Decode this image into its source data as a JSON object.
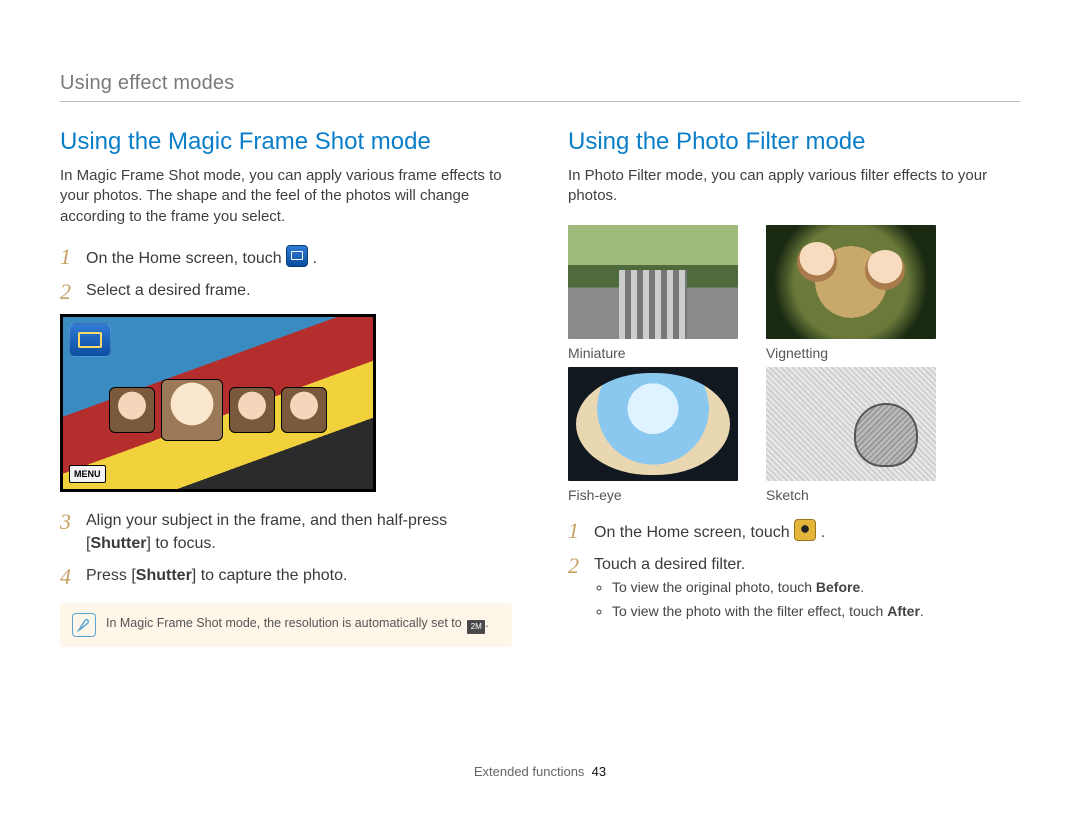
{
  "breadcrumb": "Using effect modes",
  "left": {
    "title": "Using the Magic Frame Shot mode",
    "intro": "In Magic Frame Shot mode, you can apply various frame effects to your photos. The shape and the feel of the photos will change according to the frame you select.",
    "steps": {
      "s1_a": "On the Home screen, touch ",
      "s1_b": ".",
      "s2": "Select a desired frame.",
      "s3_a": "Align your subject in the frame, and then half-press [",
      "s3_bold": "Shutter",
      "s3_b": "] to focus.",
      "s4_a": "Press [",
      "s4_bold": "Shutter",
      "s4_b": "] to capture the photo."
    },
    "screenshot": {
      "menu_label": "MENU"
    },
    "note": {
      "text_a": "In Magic Frame Shot mode, the resolution is automatically set to ",
      "res_label": "2M",
      "text_b": "."
    }
  },
  "right": {
    "title": "Using the Photo Filter mode",
    "intro": "In Photo Filter mode, you can apply various filter effects to your photos.",
    "filters": {
      "miniature": "Miniature",
      "vignetting": "Vignetting",
      "fisheye": "Fish-eye",
      "sketch": "Sketch"
    },
    "steps": {
      "s1_a": "On the Home screen, touch ",
      "s1_b": ".",
      "s2": "Touch a desired filter."
    },
    "bullets": {
      "b1_a": "To view the original photo, touch ",
      "b1_bold": "Before",
      "b1_b": ".",
      "b2_a": "To view the photo with the filter effect, touch ",
      "b2_bold": "After",
      "b2_b": "."
    }
  },
  "footer": {
    "label": "Extended functions",
    "page": "43"
  }
}
